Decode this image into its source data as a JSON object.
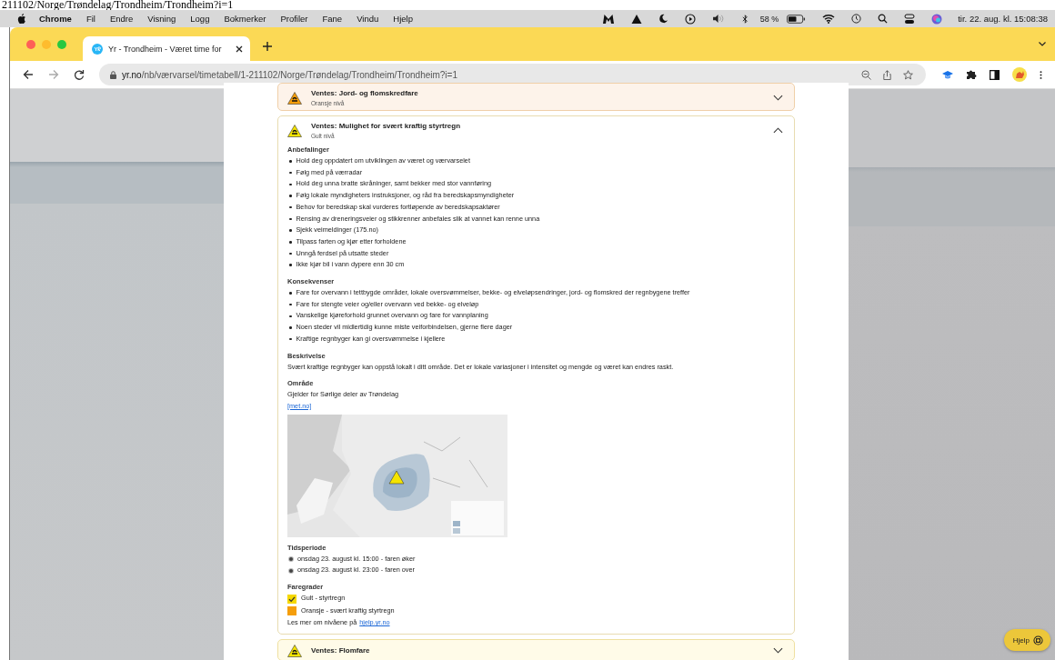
{
  "caption": "211102/Norge/Trøndelag/Trondheim/Trondheim?i=1",
  "menubar": {
    "app": "Chrome",
    "menus": [
      "Fil",
      "Endre",
      "Visning",
      "Logg",
      "Bokmerker",
      "Profiler",
      "Fane",
      "Vindu",
      "Hjelp"
    ],
    "battery": "58 %",
    "clock": "tir. 22. aug. kl. 15:08:38"
  },
  "tabs": [
    {
      "title": "Yr - Trondheim - Været time for",
      "selected": true
    }
  ],
  "nav": [
    {
      "kind": "back",
      "disabled": false
    },
    {
      "kind": "forward",
      "disabled": true
    },
    {
      "kind": "reload",
      "disabled": false
    }
  ],
  "address": {
    "host": "yr.no",
    "path": "/nb/værvarsel/timetabell/1-211102/Norge/Trøndelag/Trondheim/Trondheim?i=1"
  },
  "warnings": [
    {
      "title": "Ventes: Jord- og flomskredfare",
      "level_text": "Oransje nivå",
      "color": "#f59e0b",
      "expanded": false
    },
    {
      "title": "Ventes: Mulighet for svært kraftig styrtregn",
      "level_text": "Gult nivå",
      "color": "#f5e400",
      "expanded": true,
      "recommendations": {
        "heading": "Anbefalinger",
        "items": [
          "Hold deg oppdatert om utviklingen av været og værvarselet",
          "Følg med på værradar",
          "Hold deg unna bratte skråninger, samt bekker med stor vannføring",
          "Følg lokale myndigheters instruksjoner, og råd fra beredskapsmyndigheter",
          "Behov for beredskap skal vurderes fortløpende av beredskapsaktører",
          "Rensing av dreneringsveier og stikkrenner anbefales slik at vannet kan renne unna",
          "Sjekk veimeldinger (175.no)",
          "Tilpass farten og kjør etter forholdene",
          "Unngå ferdsel på utsatte steder",
          "Ikke kjør bil i vann dypere enn 30 cm"
        ]
      },
      "consequences": {
        "heading": "Konsekvenser",
        "items": [
          "Fare for overvann i tettbygde områder, lokale oversvømmelser, bekke- og elveløpsendringer, jord- og flomskred der regnbygene treffer",
          "Fare for stengte veier og/eller overvann ved bekke- og elveløp",
          "Vanskelige kjøreforhold grunnet overvann og fare for vannplaning",
          "Noen steder vil midlertidig kunne miste veiforbindelsen, gjerne flere dager",
          "Kraftige regnbyger kan gi oversvømmelse i kjellere"
        ]
      },
      "description": {
        "heading": "Beskrivelse",
        "text": "Svært kraftige regnbyger kan oppstå lokalt i ditt område. Det er lokale variasjoner i intensitet og mengde og været kan endres raskt."
      },
      "area": {
        "heading": "Område",
        "text": "Gjelder for Sørlige deler av Trøndelag",
        "link": "[met.no]"
      },
      "period": {
        "heading": "Tidsperiode",
        "items": [
          "onsdag 23. august kl. 15:00 - faren øker",
          "onsdag 23. august kl. 23:00 - faren over"
        ]
      },
      "levels": {
        "heading": "Faregrader",
        "items": [
          {
            "label": "Gult - styrtregn",
            "color": "#f5d800",
            "checked": true
          },
          {
            "label": "Oransje - svært kraftig styrtregn",
            "color": "#f59e0b",
            "checked": false
          }
        ],
        "more_text": "Les mer om nivåene på",
        "more_link": "hjelp.yr.no"
      }
    },
    {
      "title": "Ventes: Flomfare",
      "color": "#f5e400",
      "expanded": false
    }
  ],
  "help_button": "Hjelp"
}
